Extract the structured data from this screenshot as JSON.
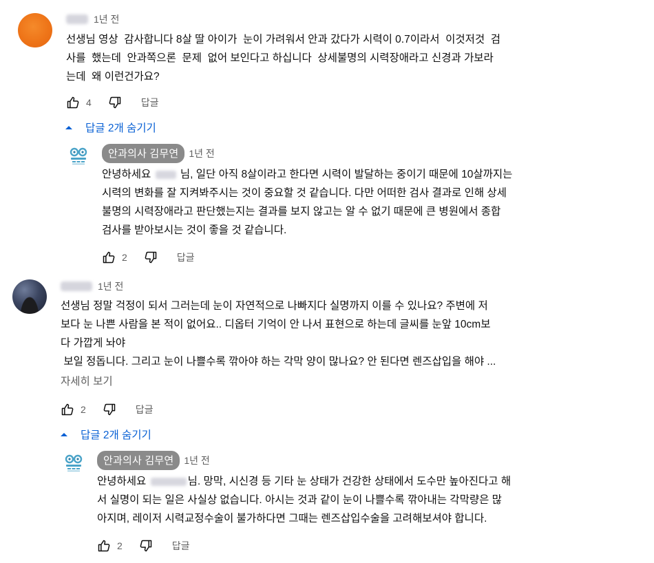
{
  "comments": [
    {
      "time": "1년 전",
      "text": "선생님 영상  감사합니다 8살 딸 아이가  눈이 가려워서 안과 갔다가 시력이 0.7이라서  이것저것  검\n사를  했는데  안과쪽으론  문제  없어 보인다고 하십니다  상세불명의 시력장애라고 신경과 가보라\n는데  왜 이런건가요?",
      "likes": "4",
      "reply_label": "답글",
      "replies_toggle": "답글 2개 숨기기",
      "reply": {
        "author": "안과의사 김무연",
        "time": "1년 전",
        "text_before": "안녕하세요 ",
        "text_after": " 님, 일단 아직 8살이라고 한다면 시력이 발달하는 중이기 때문에 10살까지는\n시력의 변화를 잘 지켜봐주시는 것이 중요할 것 같습니다. 다만 어떠한 검사 결과로 인해 상세\n불명의 시력장애라고 판단했는지는 결과를 보지 않고는 알 수 없기 때문에 큰 병원에서 종합\n검사를 받아보시는 것이 좋을 것 같습니다.",
        "likes": "2",
        "reply_label": "답글"
      }
    },
    {
      "time": "1년 전",
      "text": "선생님 정말 걱정이 되서 그러는데 눈이 자연적으로 나빠지다 실명까지 이를 수 있나요? 주변에 저\n보다 눈 나쁜 사람을 본 적이 없어요.. 디옵터 기억이 안 나서 표현으로 하는데 글씨를 눈앞 10cm보\n다 가깝게 놔야\n 보일 정돕니다. 그리고 눈이 나쁠수록 깎아야 하는 각막 양이 많나요? 안 된다면 렌즈삽입을 해야 ...",
      "more_label": "자세히 보기",
      "likes": "2",
      "reply_label": "답글",
      "replies_toggle": "답글 2개 숨기기",
      "reply": {
        "author": "안과의사 김무연",
        "time": "1년 전",
        "text_before": "안녕하세요 ",
        "text_after": "님. 망막, 시신경 등 기타 눈 상태가 건강한 상태에서 도수만 높아진다고 해\n서 실명이 되는 일은 사실상 없습니다. 아시는 것과 같이 눈이 나쁠수록 깎아내는 각막량은 많\n아지며, 레이저 시력교정수술이 불가하다면 그때는 렌즈삽입수술을 고려해보셔야 합니다.",
        "likes": "2",
        "reply_label": "답글"
      }
    }
  ],
  "icons": {
    "like": "thumb-up-icon",
    "dislike": "thumb-down-icon",
    "toggle": "chevron-up-icon",
    "clinic_avatar": "eye-clinic-logo"
  },
  "colors": {
    "link": "#065fd4",
    "secondary": "#606060",
    "author_chip": "#8a8a8a",
    "avatar_orange": "#ee7418"
  }
}
